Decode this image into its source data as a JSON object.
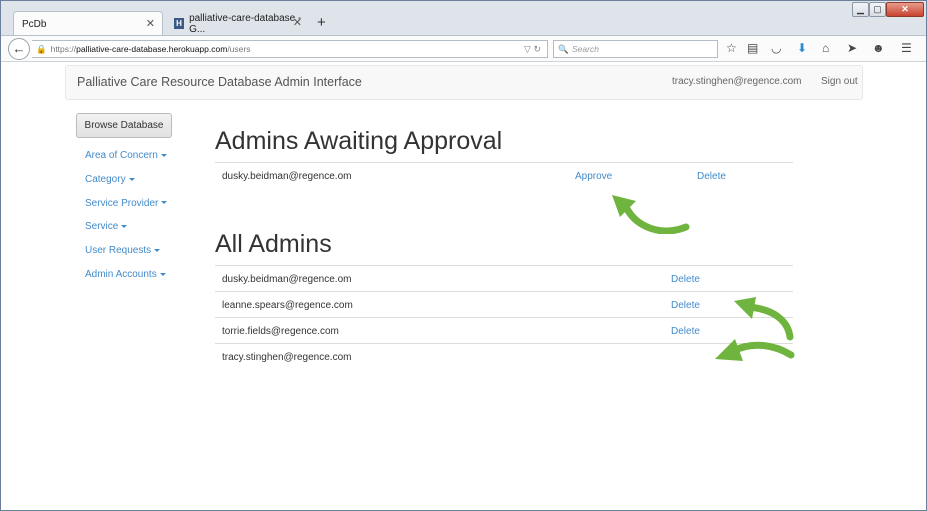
{
  "browser": {
    "tabs": [
      {
        "title": "PcDb",
        "active": true
      },
      {
        "title": "palliative-care-database - G...",
        "active": false
      }
    ],
    "new_tab": "+",
    "url": {
      "scheme": "https://",
      "host": "palliative-care-database.herokuapp.com",
      "path": "/users"
    },
    "search_placeholder": "Search"
  },
  "app": {
    "title": "Palliative Care Resource Database Admin Interface",
    "user_email": "tracy.stinghen@regence.com",
    "sign_out": "Sign out"
  },
  "sidebar": {
    "browse_button": "Browse Database",
    "items": [
      {
        "label": "Area of Concern"
      },
      {
        "label": "Category"
      },
      {
        "label": "Service Provider"
      },
      {
        "label": "Service"
      },
      {
        "label": "User Requests"
      },
      {
        "label": "Admin Accounts"
      }
    ]
  },
  "pending": {
    "heading": "Admins Awaiting Approval",
    "rows": [
      {
        "email": "dusky.beidman@regence.om",
        "approve": "Approve",
        "delete": "Delete"
      }
    ]
  },
  "all_admins": {
    "heading": "All Admins",
    "rows": [
      {
        "email": "dusky.beidman@regence.om",
        "delete": "Delete"
      },
      {
        "email": "leanne.spears@regence.com",
        "delete": "Delete"
      },
      {
        "email": "torrie.fields@regence.com",
        "delete": "Delete"
      },
      {
        "email": "tracy.stinghen@regence.com",
        "delete": ""
      }
    ]
  },
  "colors": {
    "link": "#428bca",
    "annotation_arrow": "#6fb43f"
  }
}
